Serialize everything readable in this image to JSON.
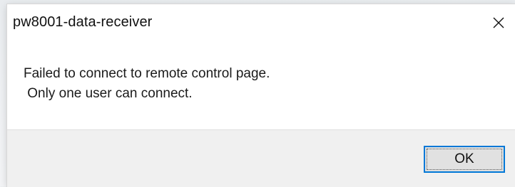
{
  "window": {
    "title": "pw8001-data-receiver",
    "close_icon": "close-icon"
  },
  "message": {
    "text": "Failed to connect to remote control page.\n Only one user can connect."
  },
  "buttons": {
    "ok_label": "OK"
  },
  "colors": {
    "focus_border": "#0078d7",
    "footer_bg": "#f0f0f0",
    "button_bg": "#e1e1e1"
  }
}
